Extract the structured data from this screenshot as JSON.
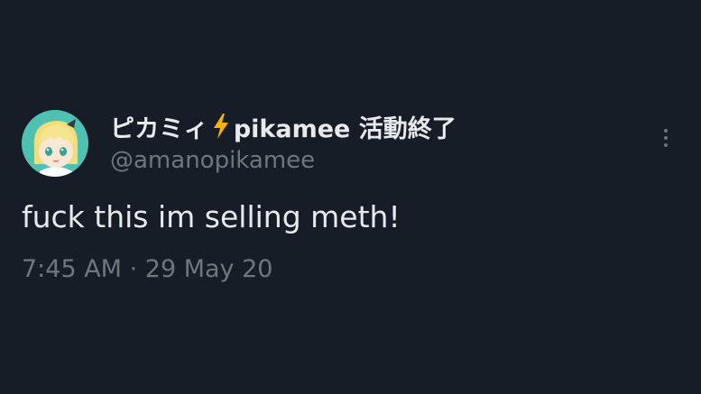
{
  "tweet": {
    "display_name_part1": "ピカミィ",
    "bolt_icon": "lightning-bolt-emoji",
    "display_name_part2": "pikamee 活動終了",
    "handle": "@amanopikamee",
    "text": "fuck this im selling meth!",
    "time": "7:45 AM",
    "separator": "·",
    "date": "29 May 20",
    "more_icon": "more-vertical-icon"
  },
  "colors": {
    "background": "#161d27",
    "primary_text": "#e7e9ea",
    "secondary_text": "#71767b",
    "bolt": "#f4b400",
    "avatar_bg": "#4ec1b3"
  }
}
